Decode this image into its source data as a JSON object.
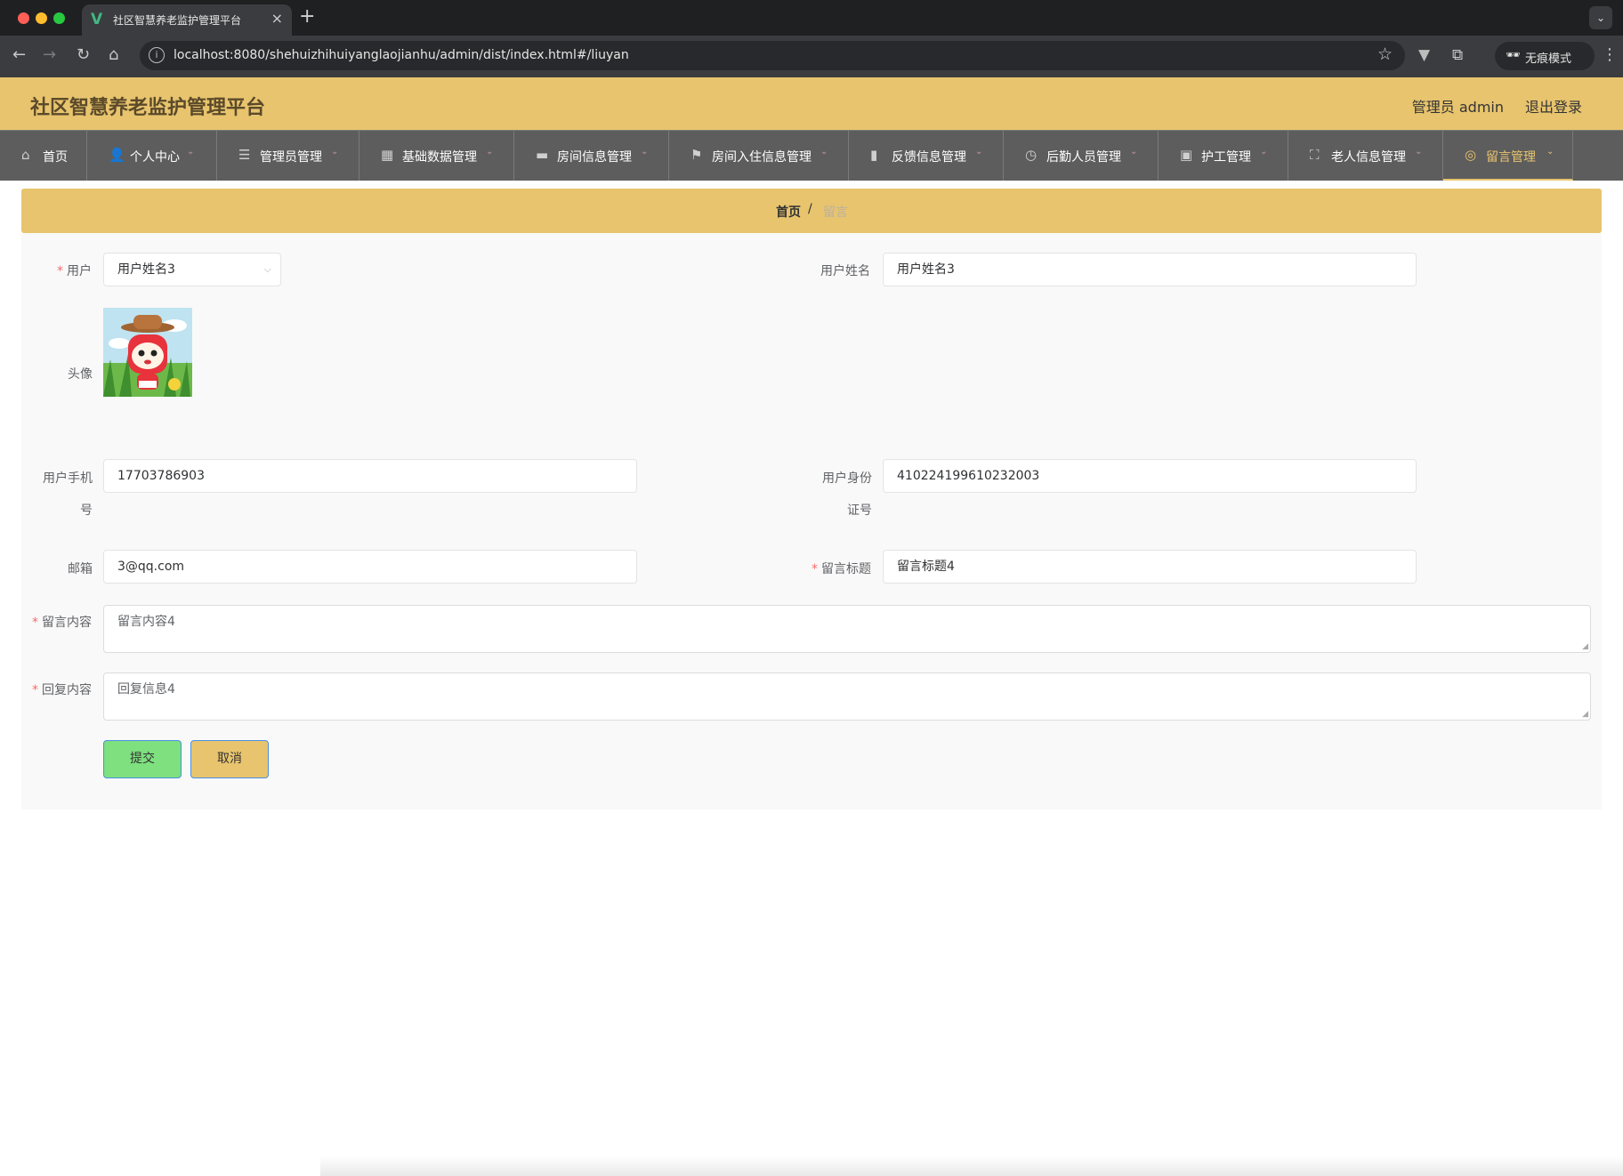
{
  "browser": {
    "tab_title": "社区智慧养老监护管理平台",
    "url": "localhost:8080/shehuizhihuiyanglaojianhu/admin/dist/index.html#/liuyan",
    "incognito_label": "无痕模式"
  },
  "header": {
    "title": "社区智慧养老监护管理平台",
    "user": "管理员 admin",
    "logout": "退出登录"
  },
  "nav": {
    "items": [
      {
        "label": "首页",
        "icon": "home-icon"
      },
      {
        "label": "个人中心",
        "icon": "user-icon"
      },
      {
        "label": "管理员管理",
        "icon": "list-icon"
      },
      {
        "label": "基础数据管理",
        "icon": "grid-icon"
      },
      {
        "label": "房间信息管理",
        "icon": "wallet-icon"
      },
      {
        "label": "房间入住信息管理",
        "icon": "flag-icon"
      },
      {
        "label": "反馈信息管理",
        "icon": "chart-icon"
      },
      {
        "label": "后勤人员管理",
        "icon": "clock-icon"
      },
      {
        "label": "护工管理",
        "icon": "trend-icon"
      },
      {
        "label": "老人信息管理",
        "icon": "fullscreen-icon"
      },
      {
        "label": "留言管理",
        "icon": "compass-icon"
      }
    ],
    "active": "留言管理"
  },
  "breadcrumb": {
    "home": "首页",
    "separator": "/",
    "current": "留言"
  },
  "form": {
    "user": {
      "label": "用户",
      "value": "用户姓名3"
    },
    "user_name": {
      "label": "用户姓名",
      "value": "用户姓名3"
    },
    "avatar": {
      "label": "头像"
    },
    "phone": {
      "label_line1": "用户手机",
      "label_line2": "号",
      "value": "17703786903"
    },
    "id_card": {
      "label_line1": "用户身份",
      "label_line2": "证号",
      "value": "410224199610232003"
    },
    "email": {
      "label": "邮箱",
      "value": "3@qq.com"
    },
    "msg_title": {
      "label": "留言标题",
      "value": "留言标题4"
    },
    "msg_content": {
      "label": "留言内容",
      "value": "留言内容4"
    },
    "reply_content": {
      "label": "回复内容",
      "value": "回复信息4"
    },
    "submit": "提交",
    "cancel": "取消"
  },
  "colors": {
    "header_bg": "#e8c46e",
    "nav_bg": "#5d5d5d",
    "submit_bg": "#7ee07e",
    "cancel_bg": "#e8c46e",
    "required": "#f56c6c"
  }
}
